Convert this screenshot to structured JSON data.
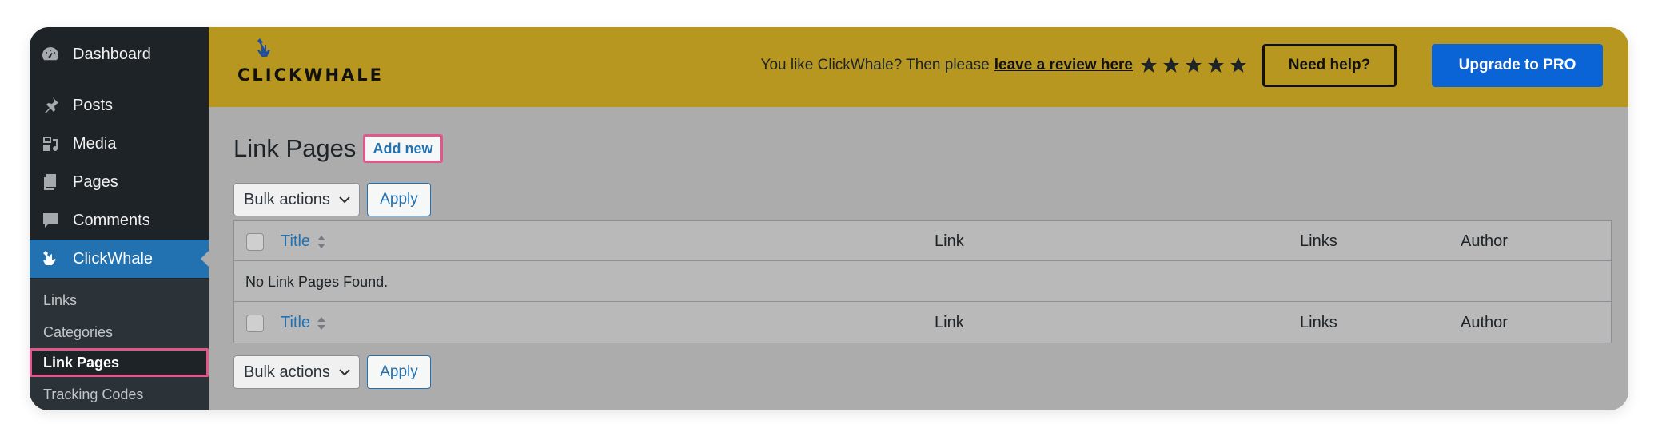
{
  "sidebar": {
    "menu": [
      {
        "label": "Dashboard",
        "icon": "dashboard-icon"
      },
      {
        "label": "Posts",
        "icon": "pin-icon"
      },
      {
        "label": "Media",
        "icon": "media-icon"
      },
      {
        "label": "Pages",
        "icon": "pages-icon"
      },
      {
        "label": "Comments",
        "icon": "comment-icon"
      },
      {
        "label": "ClickWhale",
        "icon": "clickwhale-icon",
        "active": true
      }
    ],
    "submenu": [
      {
        "label": "Links"
      },
      {
        "label": "Categories"
      },
      {
        "label": "Link Pages",
        "current": true
      },
      {
        "label": "Tracking Codes"
      }
    ]
  },
  "banner": {
    "logo_text": "CLICKWHALE",
    "review_text": "You like ClickWhale? Then please",
    "review_link": "leave a review here",
    "stars": 5,
    "help_label": "Need help?",
    "pro_label": "Upgrade to PRO",
    "colors": {
      "banner": "#b89720",
      "pro": "#0a64d6"
    }
  },
  "main": {
    "title": "Link Pages",
    "add_new": "Add new",
    "bulk_actions": "Bulk actions",
    "apply": "Apply",
    "table": {
      "columns": [
        "Title",
        "Link",
        "Links",
        "Author"
      ],
      "empty_message": "No Link Pages Found."
    }
  }
}
